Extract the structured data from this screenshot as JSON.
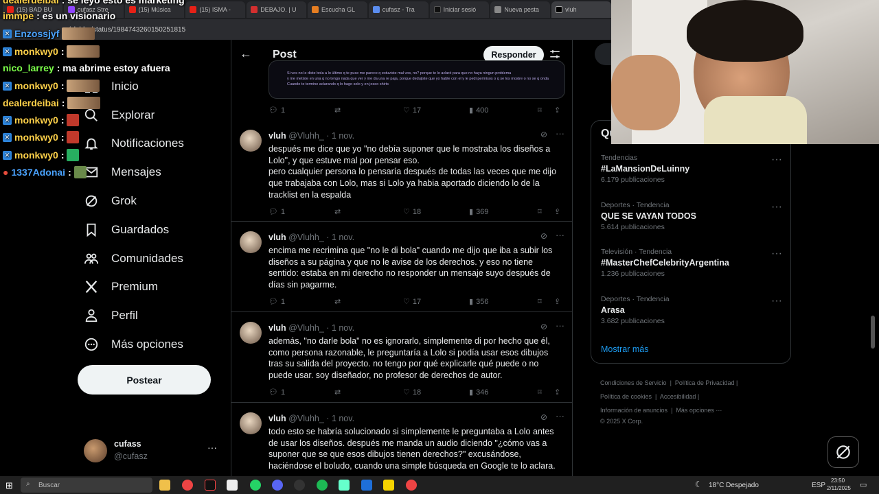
{
  "browser": {
    "tabs": [
      "(15) BAD BU",
      "cufasz Stre",
      "(15) Música",
      "(15) ISMA -",
      "DEBAJO. | U",
      "Escucha GL",
      "cufasz - Tra",
      "Iniciar sesió",
      "Nueva pesta",
      "vluh"
    ],
    "url": "/vluhh_/status/1984743260150251815"
  },
  "chat": [
    {
      "user": "dealerdeibai",
      "text": ": se leyó esto es marketing",
      "color": "#ffd24a"
    },
    {
      "user": "immpe",
      "text": ": es un visionario",
      "color": "#ffd24a"
    },
    {
      "user": "Enzossjyf",
      "text": "",
      "color": "#4aa3ff"
    },
    {
      "user": "monkwy0",
      "text": ":",
      "color": "#ffd24a"
    },
    {
      "user": "nico_larrey",
      "text": ": ma abrime estoy afuera",
      "color": "#7cff4a"
    },
    {
      "user": "monkwy0",
      "text": ":",
      "color": "#ffd24a"
    },
    {
      "user": "dealerdeibai",
      "text": ":",
      "color": "#ffd24a"
    },
    {
      "user": "monkwy0",
      "text": ":",
      "color": "#ffd24a"
    },
    {
      "user": "monkwy0",
      "text": ":",
      "color": "#ffd24a"
    },
    {
      "user": "monkwy0",
      "text": ":",
      "color": "#ffd24a"
    },
    {
      "user": "1337Adonai",
      "text": ":",
      "color": "#4aa3ff"
    }
  ],
  "nav": {
    "items": [
      {
        "label": "Inicio",
        "icon": "home-icon"
      },
      {
        "label": "Explorar",
        "icon": "search-icon"
      },
      {
        "label": "Notificaciones",
        "icon": "bell-icon"
      },
      {
        "label": "Mensajes",
        "icon": "mail-icon"
      },
      {
        "label": "Grok",
        "icon": "grok-icon"
      },
      {
        "label": "Guardados",
        "icon": "bookmark-icon"
      },
      {
        "label": "Comunidades",
        "icon": "people-icon"
      },
      {
        "label": "Premium",
        "icon": "x-logo-icon"
      },
      {
        "label": "Perfil",
        "icon": "person-icon"
      },
      {
        "label": "Más opciones",
        "icon": "more-circle-icon"
      }
    ],
    "post_label": "Postear"
  },
  "profile": {
    "name": "cufass",
    "handle": "@cufasz"
  },
  "header": {
    "title": "Post",
    "reply_label": "Responder"
  },
  "media_caption": {
    "line1": "Si vos no le diste bola a lo último q te puse me parece q estuviste mal vos, no? porque te lo aclaré para que no haya ningun problema",
    "line2": "y me metiste en una q no tengo nada que ver y me da una re paja, porque dedujiste que yo hable con el y le pedi permisos o q se los mostre o no se q onda",
    "line3": "Cuando te termine aclarando q lo hago solo y en joseo shirts"
  },
  "top_actions": {
    "replies": "1",
    "likes": "17",
    "views": "400"
  },
  "tweets": [
    {
      "name": "vluh",
      "handle": "@Vluhh_",
      "date": "1 nov.",
      "text": "después me dice que yo \"no debía suponer que le mostraba los diseños a Lolo\", y que estuve mal por pensar eso.\npero cualquier persona lo pensaría después de todas las veces que me dijo que trabajaba con Lolo, mas si Lolo ya habia aportado diciendo lo de la tracklist en la espalda",
      "replies": "1",
      "likes": "18",
      "views": "369"
    },
    {
      "name": "vluh",
      "handle": "@Vluhh_",
      "date": "1 nov.",
      "text": "encima me recrimina que \"no le di bola\" cuando me dijo que iba a subir los diseños a su página y que no le avise de los derechos. y eso no tiene sentido: estaba en mi derecho no responder un mensaje suyo después de días sin pagarme.",
      "replies": "1",
      "likes": "17",
      "views": "356"
    },
    {
      "name": "vluh",
      "handle": "@Vluhh_",
      "date": "1 nov.",
      "text": "además, \"no darle bola\" no es ignorarlo, simplemente di por hecho que él, como persona razonable, le preguntaría a Lolo si podía usar esos dibujos tras su salida del proyecto. no tengo por qué explicarle qué puede o no puede usar. soy diseñador, no profesor de derechos de autor.",
      "replies": "1",
      "likes": "18",
      "views": "346"
    },
    {
      "name": "vluh",
      "handle": "@Vluhh_",
      "date": "1 nov.",
      "text": "todo esto se habría solucionado si simplemente le preguntaba a Lolo antes de usar los diseños. después me manda un audio diciendo \"¿cómo vas a suponer que se que esos dibujos tienen derechos?\" excusándose, haciéndose el boludo, cuando una simple búsqueda en Google te lo aclara.",
      "replies": "",
      "likes": "",
      "views": ""
    }
  ],
  "trends": {
    "title": "Qué está pasando",
    "items": [
      {
        "category": "Tendencias",
        "name": "#LaMansionDeLuinny",
        "count": "6.179 publicaciones"
      },
      {
        "category": "Deportes · Tendencia",
        "name": "QUE SE VAYAN TODOS",
        "count": "5.614 publicaciones"
      },
      {
        "category": "Televisión · Tendencia",
        "name": "#MasterChefCelebrityArgentina",
        "count": "1.236 publicaciones"
      },
      {
        "category": "Deportes · Tendencia",
        "name": "Arasa",
        "count": "3.682 publicaciones"
      }
    ],
    "show_more": "Mostrar más"
  },
  "footer": {
    "links": [
      "Condiciones de Servicio",
      "Política de Privacidad",
      "Política de cookies",
      "Accesibilidad",
      "Información de anuncios",
      "Más opciones ···"
    ],
    "copyright": "© 2025 X Corp."
  },
  "taskbar": {
    "search_placeholder": "Buscar",
    "weather": "18°C  Despejado",
    "lang": "ESP",
    "time": "23:50",
    "date": "2/11/2025"
  },
  "colors": {
    "bg": "#000000",
    "border": "#2f3336",
    "muted": "#71767b",
    "text": "#e7e9ea",
    "link": "#1d9bf0"
  }
}
